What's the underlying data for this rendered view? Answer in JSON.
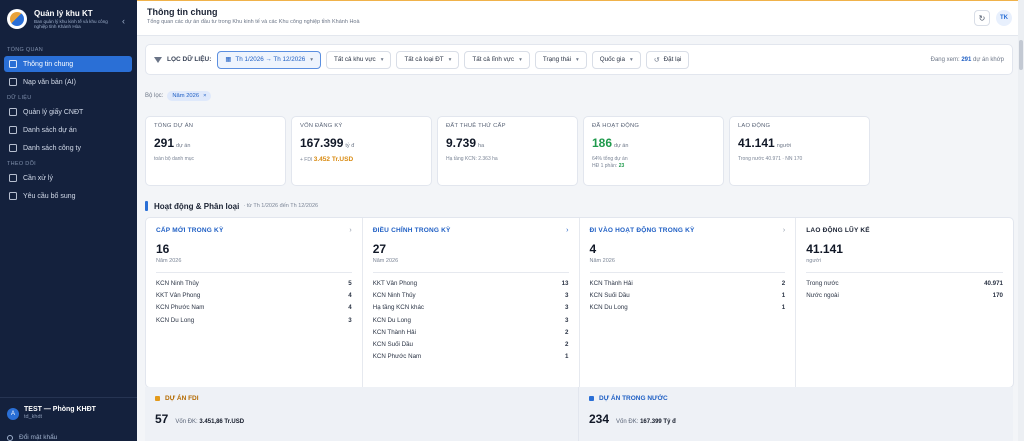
{
  "sidebar": {
    "title": "Quản lý khu KT",
    "subtitle": "Ban quản lý khu kinh tế và khu công nghiệp tỉnh Khánh Hòa",
    "sections": [
      {
        "label": "TỔNG QUAN",
        "items": [
          {
            "label": "Thông tin chung",
            "icon": "grid-icon",
            "active": true
          },
          {
            "label": "Nạp văn bản (AI)",
            "icon": "sparkle-icon"
          }
        ]
      },
      {
        "label": "DỮ LIỆU",
        "items": [
          {
            "label": "Quản lý giấy CNĐT",
            "icon": "document-icon"
          },
          {
            "label": "Danh sách dự án",
            "icon": "list-icon"
          },
          {
            "label": "Danh sách công ty",
            "icon": "building-icon"
          }
        ]
      },
      {
        "label": "THEO DÕI",
        "items": [
          {
            "label": "Cần xử lý",
            "icon": "inbox-icon"
          },
          {
            "label": "Yêu cầu bổ sung",
            "icon": "clipboard-icon"
          }
        ]
      }
    ],
    "user": {
      "initial": "A",
      "name": "TEST — Phòng KHĐT",
      "id": "td_khdt"
    },
    "change_password": "Đổi mật khẩu"
  },
  "header": {
    "title": "Thông tin chung",
    "subtitle": "Tổng quan các dự án đầu tư trong Khu kinh tế và các Khu công nghiệp tỉnh Khánh Hoà",
    "avatar": "TK"
  },
  "filters": {
    "label": "LỌC DỮ LIỆU:",
    "date_range": "Th 1/2026 → Th 12/2026",
    "area": "Tất cả khu vực",
    "type": "Tất cả loại ĐT",
    "field": "Tất cả lĩnh vực",
    "status": "Trạng thái",
    "country": "Quốc gia",
    "reset": "Đặt lại",
    "count_prefix": "Đang xem:",
    "count_value": "291",
    "count_suffix": "dự án khớp"
  },
  "applied": {
    "label": "Bộ lọc:",
    "tag": "Năm 2026"
  },
  "kpis": [
    {
      "label": "TỔNG DỰ ÁN",
      "value": "291",
      "unit": "dự án",
      "note": "toàn bộ danh mục"
    },
    {
      "label": "VỐN ĐĂNG KÝ",
      "value": "167.399",
      "unit": "tỷ đ",
      "note_prefix": "+ FDI",
      "note_fdi": "3.452 Tr.USD"
    },
    {
      "label": "ĐẤT THUÊ THỨ CẤP",
      "value": "9.739",
      "unit": "ha",
      "note": "Hạ tầng KCN: 2.363 ha"
    },
    {
      "label": "ĐÃ HOẠT ĐỘNG",
      "value": "186",
      "unit": "dự án",
      "note": "64% tổng dự án",
      "note2_prefix": "HĐ 1 phần:",
      "note2_value": "23"
    },
    {
      "label": "LAO ĐỘNG",
      "value": "41.141",
      "unit": "người",
      "note": "Trong nước 40.971 · NN 170"
    }
  ],
  "section": {
    "title": "Hoạt động & Phân loại",
    "subtitle": "· từ Th 1/2026 đến Th 12/2026"
  },
  "columns": [
    {
      "title": "CẤP MỚI TRONG KỲ",
      "value": "16",
      "sub": "Năm 2026",
      "rows": [
        {
          "name": "KCN Ninh Thủy",
          "count": "5"
        },
        {
          "name": "KKT Vân Phong",
          "count": "4"
        },
        {
          "name": "KCN Phước Nam",
          "count": "4"
        },
        {
          "name": "KCN Du Long",
          "count": "3"
        }
      ]
    },
    {
      "title": "ĐIỀU CHỈNH TRONG KỲ",
      "value": "27",
      "sub": "Năm 2026",
      "rows": [
        {
          "name": "KKT Vân Phong",
          "count": "13"
        },
        {
          "name": "KCN Ninh Thủy",
          "count": "3"
        },
        {
          "name": "Hạ tầng KCN khác",
          "count": "3"
        },
        {
          "name": "KCN Du Long",
          "count": "3"
        },
        {
          "name": "KCN Thành Hải",
          "count": "2"
        },
        {
          "name": "KCN Suối Dầu",
          "count": "2"
        },
        {
          "name": "KCN Phước Nam",
          "count": "1"
        }
      ]
    },
    {
      "title": "ĐI VÀO HOẠT ĐỘNG TRONG KỲ",
      "value": "4",
      "sub": "Năm 2026",
      "rows": [
        {
          "name": "KCN Thành Hải",
          "count": "2"
        },
        {
          "name": "KCN Suối Dầu",
          "count": "1"
        },
        {
          "name": "KCN Du Long",
          "count": "1"
        }
      ]
    },
    {
      "title": "LAO ĐỘNG LŨY KẾ",
      "value": "41.141",
      "sub": "người",
      "rows": [
        {
          "name": "Trong nước",
          "count": "40.971"
        },
        {
          "name": "Nước ngoài",
          "count": "170"
        }
      ]
    }
  ],
  "bottom": [
    {
      "title": "DỰ ÁN FDI",
      "value": "57",
      "meta_label": "Vốn ĐK:",
      "meta_value": "3.451,86 Tr.USD"
    },
    {
      "title": "DỰ ÁN TRONG NƯỚC",
      "value": "234",
      "meta_label": "Vốn ĐK:",
      "meta_value": "167.399 Tỷ đ"
    }
  ]
}
